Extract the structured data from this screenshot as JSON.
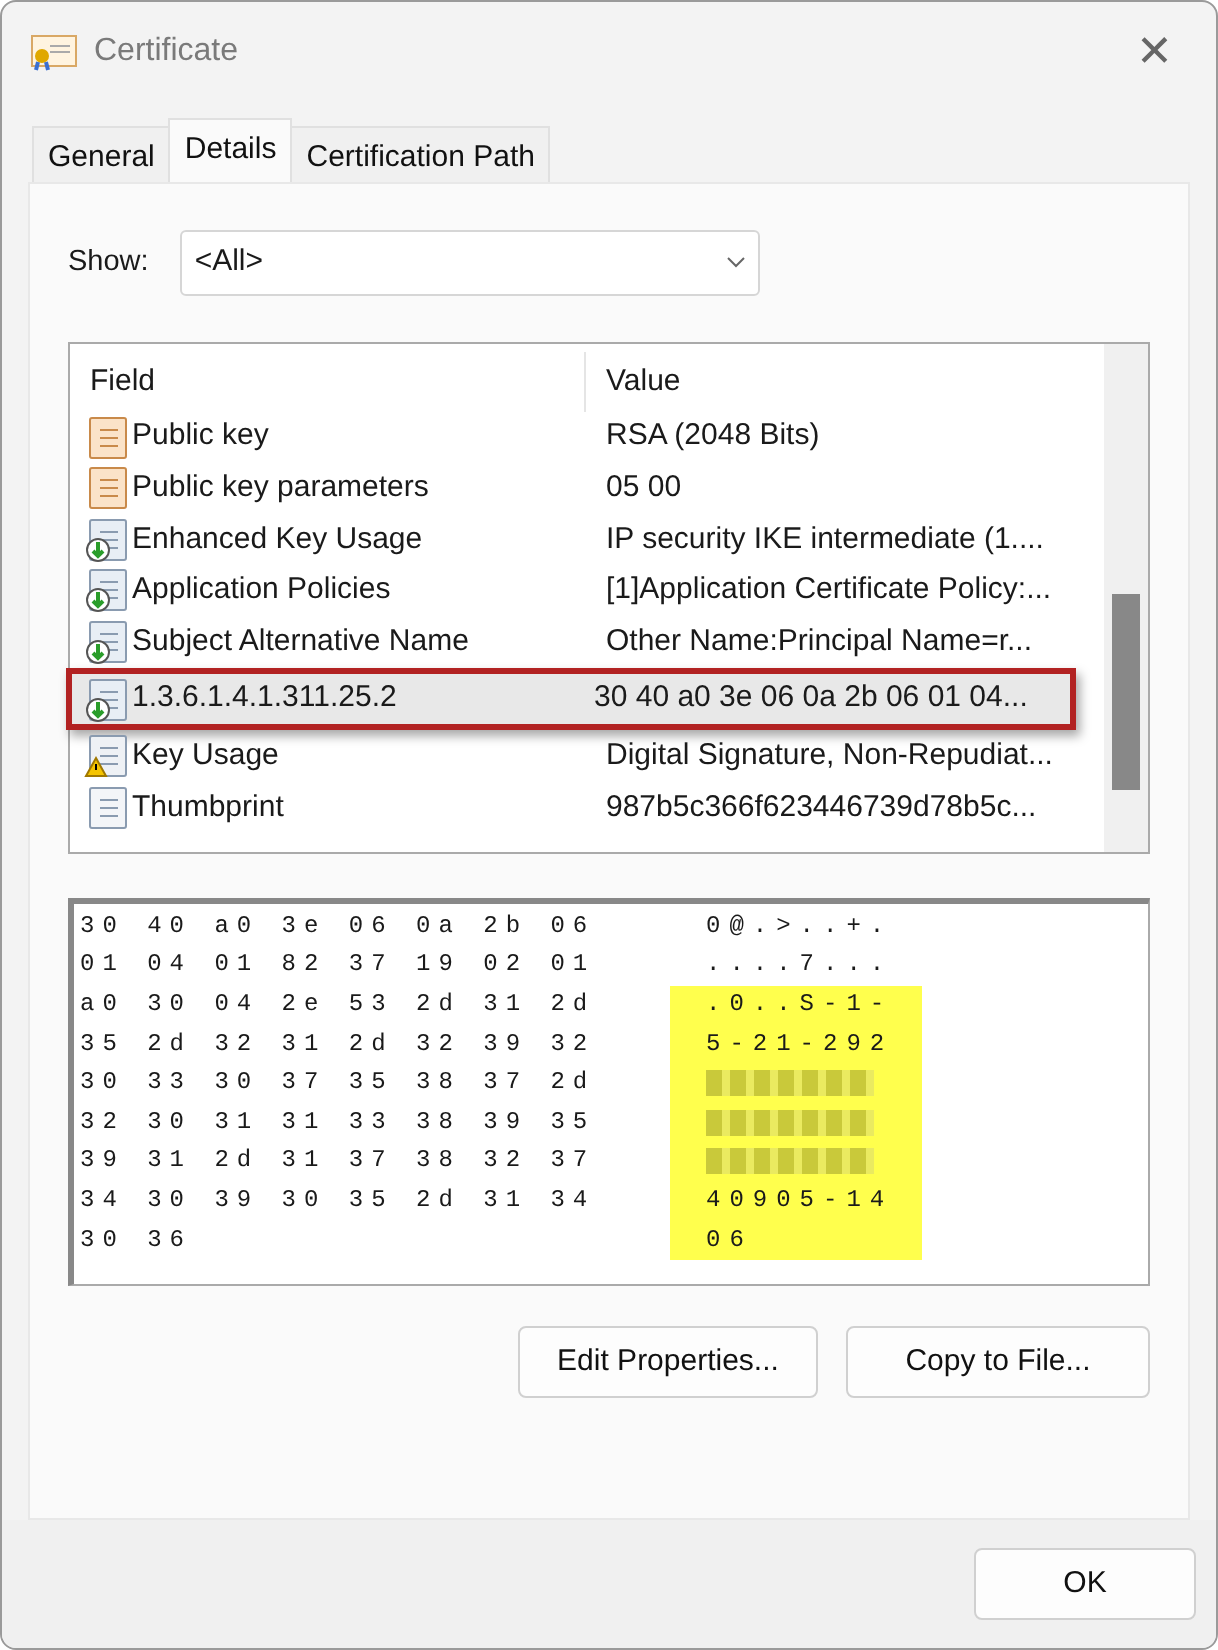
{
  "window": {
    "title": "Certificate",
    "close": "✕"
  },
  "tabs": [
    {
      "label": "General",
      "selected": false
    },
    {
      "label": "Details",
      "selected": true
    },
    {
      "label": "Certification Path",
      "selected": false
    }
  ],
  "show": {
    "label": "Show:",
    "value": "<All>"
  },
  "fields": {
    "columns": [
      "Field",
      "Value"
    ],
    "rows": [
      {
        "kind": "property",
        "field": "Public key",
        "value": "RSA (2048 Bits)",
        "selected": false
      },
      {
        "kind": "property",
        "field": "Public key parameters",
        "value": "05 00",
        "selected": false
      },
      {
        "kind": "extension",
        "field": "Enhanced Key Usage",
        "value": "IP security IKE intermediate (1....",
        "selected": false
      },
      {
        "kind": "extension",
        "field": "Application Policies",
        "value": "[1]Application Certificate Policy:...",
        "selected": false
      },
      {
        "kind": "extension",
        "field": "Subject Alternative Name",
        "value": "Other Name:Principal Name=r...",
        "selected": false
      },
      {
        "kind": "extension",
        "field": "1.3.6.1.4.1.311.25.2",
        "value": "30 40 a0 3e 06 0a 2b 06 01 04...",
        "selected": true
      },
      {
        "kind": "warning",
        "field": "Key Usage",
        "value": "Digital Signature, Non-Repudiat...",
        "selected": false
      },
      {
        "kind": "plain",
        "field": "Thumbprint",
        "value": "987b5c366f623446739d78b5c...",
        "selected": false
      }
    ]
  },
  "hex": [
    {
      "bytes": "30 40 a0 3e 06 0a 2b 06",
      "ascii": "0@.>..+.",
      "kind": "plain",
      "highlighted": false
    },
    {
      "bytes": "01 04 01 82 37 19 02 01",
      "ascii": "....7...",
      "kind": "plain",
      "highlighted": false
    },
    {
      "bytes": "a0 30 04 2e 53 2d 31 2d",
      "ascii": ".0..S-1-",
      "kind": "plain",
      "highlighted": true
    },
    {
      "bytes": "35 2d 32 31 2d 32 39 32",
      "ascii": "5-21-292",
      "kind": "plain",
      "highlighted": true
    },
    {
      "bytes": "30 33 30 37 35 38 37 2d",
      "kind": "redacted",
      "highlighted": true
    },
    {
      "bytes": "32 30 31 31 33 38 39 35",
      "kind": "redacted",
      "highlighted": true
    },
    {
      "bytes": "39 31 2d 31 37 38 32 37",
      "kind": "redacted",
      "highlighted": true
    },
    {
      "bytes": "34 30 39 30 35 2d 31 34",
      "ascii": "40905-14",
      "kind": "plain",
      "highlighted": true
    },
    {
      "bytes": "30 36",
      "ascii": "06",
      "kind": "plain",
      "highlighted": true
    }
  ],
  "buttons": [
    "Edit Properties...",
    "Copy to File..."
  ],
  "footer_button": "OK"
}
